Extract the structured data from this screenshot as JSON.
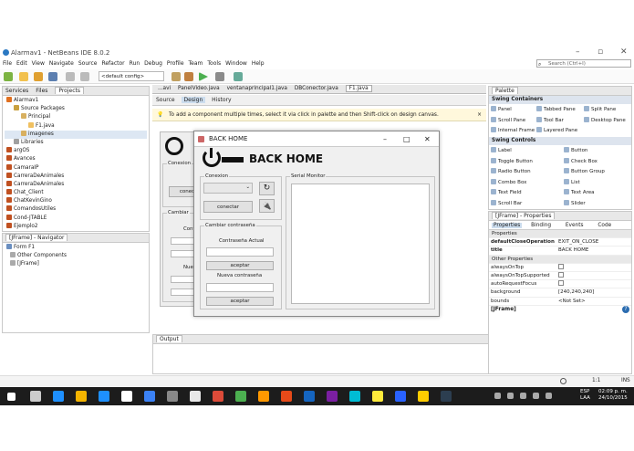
{
  "window": {
    "title": "Alarmav1 - NetBeans IDE 8.0.2"
  },
  "menu": [
    "File",
    "Edit",
    "View",
    "Navigate",
    "Source",
    "Refactor",
    "Run",
    "Debug",
    "Profile",
    "Team",
    "Tools",
    "Window",
    "Help"
  ],
  "toolbar": {
    "config": "<default config>"
  },
  "search": {
    "placeholder": "Search (Ctrl+I)"
  },
  "projects": {
    "tabs": [
      "Services",
      "Files",
      "Projects"
    ],
    "tree": [
      "Alarmav1",
      "Source Packages",
      "Principal",
      "F1.java",
      "imagenes",
      "Libraries",
      "argOS",
      "Avances",
      "CamaraIP",
      "CarreraDeAnimales",
      "CarreraDeAnimales",
      "Chat_Client",
      "ChatKevinGino",
      "ComandosUtiles",
      "Cond-JTABLE",
      "Ejemplo2"
    ]
  },
  "navigator": {
    "title": "[JFrame] - Navigator",
    "tree": [
      "Form F1",
      "Other Components",
      "[JFrame]"
    ]
  },
  "editor": {
    "tabs": [
      "...avi",
      "PanelVideo.java",
      "ventanaprincipal1.java",
      "DBConector.java",
      "F1.java"
    ],
    "source": "Source",
    "design": "Design",
    "history": "History",
    "info": "To add a component multiple times, select it via click in palette and then Shift-click on design canvas."
  },
  "bg_form": {
    "conexion": "Conexion",
    "conectar": "conec",
    "cambiar": "Cambiar",
    "contra": "Contr",
    "nueva": "Nuev"
  },
  "dialog": {
    "title": "BACK HOME",
    "heading": "BACK HOME",
    "conexion": "Conexion",
    "conectar": "conectar",
    "cambiar": "Cambiar contraseña",
    "actual": "Contraseña Actual",
    "aceptar1": "aceptar",
    "nueva": "Nueva contraseña",
    "aceptar2": "aceptar",
    "serial": "Serial Monitor"
  },
  "output": {
    "title": "Output"
  },
  "palette": {
    "title": "Palette",
    "sec1": "Swing Containers",
    "containers": [
      "Panel",
      "Tabbed Pane",
      "Split Pane",
      "Scroll Pane",
      "Tool Bar",
      "Desktop Pane",
      "Internal Frame",
      "Layered Pane"
    ],
    "sec2": "Swing Controls",
    "controls": [
      "Label",
      "Button",
      "Toggle Button",
      "Check Box",
      "Radio Button",
      "Button Group",
      "Combo Box",
      "List",
      "Text Field",
      "Text Area",
      "Scroll Bar",
      "Slider"
    ]
  },
  "properties": {
    "title": "[JFrame] - Properties",
    "tabs": [
      "Properties",
      "Binding",
      "Events",
      "Code"
    ],
    "sec1": "Properties",
    "rows": [
      {
        "k": "defaultCloseOperation",
        "v": "EXIT_ON_CLOSE"
      },
      {
        "k": "title",
        "v": "BACK HOME"
      }
    ],
    "sec2": "Other Properties",
    "rows2": [
      {
        "k": "alwaysOnTop",
        "v": ""
      },
      {
        "k": "alwaysOnTopSupported",
        "v": ""
      },
      {
        "k": "autoRequestFocus",
        "v": ""
      },
      {
        "k": "background",
        "v": "[240,240,240]"
      },
      {
        "k": "bounds",
        "v": "<Not Set>"
      }
    ],
    "footer": "[JFrame]"
  },
  "status": {
    "pos": "1:1",
    "mode": "INS"
  },
  "taskbar": {
    "lang": "ESP",
    "region": "LAA",
    "time": "02:09 p. m.",
    "date": "24/10/2015"
  }
}
